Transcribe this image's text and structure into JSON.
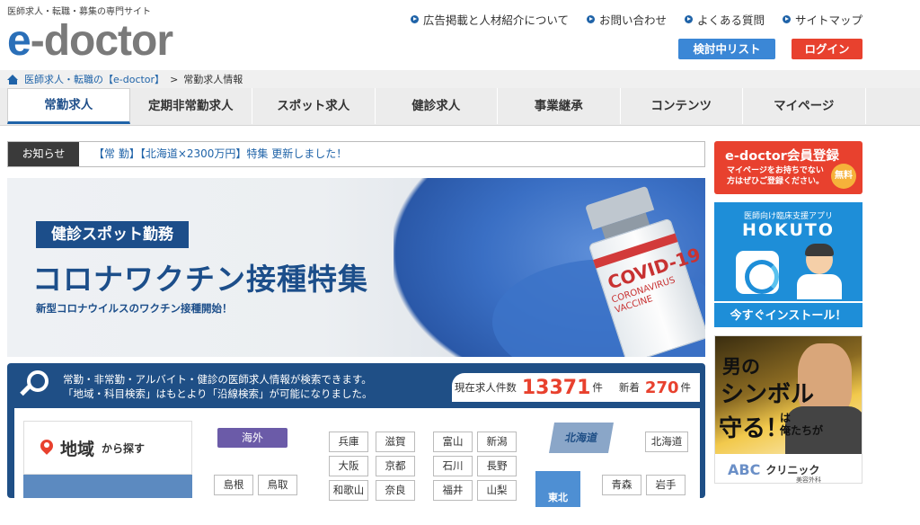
{
  "header": {
    "tagline": "医師求人・転職・募集の専門サイト",
    "logo_e": "e",
    "logo_rest": "-doctor",
    "links": [
      {
        "label": "広告掲載と人材紹介について"
      },
      {
        "label": "お問い合わせ"
      },
      {
        "label": "よくある質問"
      },
      {
        "label": "サイトマップ"
      }
    ],
    "list_button": "検討中リスト",
    "login_button": "ログイン"
  },
  "breadcrumb": {
    "home": "医師求人・転職の【e-doctor】",
    "sep": ">",
    "current": "常勤求人情報"
  },
  "nav": {
    "tabs": [
      {
        "label": "常勤求人"
      },
      {
        "label": "定期非常勤求人"
      },
      {
        "label": "スポット求人"
      },
      {
        "label": "健診求人"
      },
      {
        "label": "事業継承"
      },
      {
        "label": "コンテンツ"
      },
      {
        "label": "マイページ"
      }
    ]
  },
  "news": {
    "label": "お知らせ",
    "text": "【常 勤】【北海道×2300万円】特集 更新しました！"
  },
  "hero": {
    "badge": "健診スポット勤務",
    "title": "コロナワクチン接種特集",
    "subtitle": "新型コロナウイルスのワクチン接種開始！",
    "vial_label": "COVID-19",
    "vial_sub1": "CORONAVIRUS",
    "vial_sub2": "VACCINE"
  },
  "search": {
    "desc_line1": "常勤・非常勤・アルバイト・健診の医師求人情報が検索できます。",
    "desc_line2": "「地域・科目検索」はもとより「沿線検索」が可能になりました。",
    "count_label": "現在求人件数",
    "count_value": "13371",
    "count_unit": "件",
    "new_label": "新着",
    "new_value": "270",
    "new_unit": "件",
    "area_big": "地域",
    "area_small": "から探す",
    "overseas": "海外",
    "prefs": [
      "兵庫",
      "滋賀",
      "富山",
      "新潟",
      "大阪",
      "京都",
      "石川",
      "長野",
      "和歌山",
      "奈良",
      "福井",
      "山梨",
      "島根",
      "鳥取",
      "北海道",
      "青森",
      "岩手"
    ],
    "region_hokkaido": "北海道",
    "region_tohoku": "東北"
  },
  "sidebar": {
    "member_title": "e-doctor会員登録",
    "member_desc1": "マイページをお持ちでない",
    "member_desc2": "方はぜひご登録ください。",
    "member_free": "無料",
    "app_caption": "医師向け臨床支援アプリ",
    "app_name": "HOKUTO",
    "app_cta": "今すぐインストール！",
    "ad_l1": "男の",
    "ad_l2": "シンボル",
    "ad_l3a": "は",
    "ad_l3b": "俺たちが",
    "ad_l4": "守る！",
    "ad_logo": "ABC",
    "ad_clinic": "クリニック",
    "ad_sub": "美容外科"
  }
}
